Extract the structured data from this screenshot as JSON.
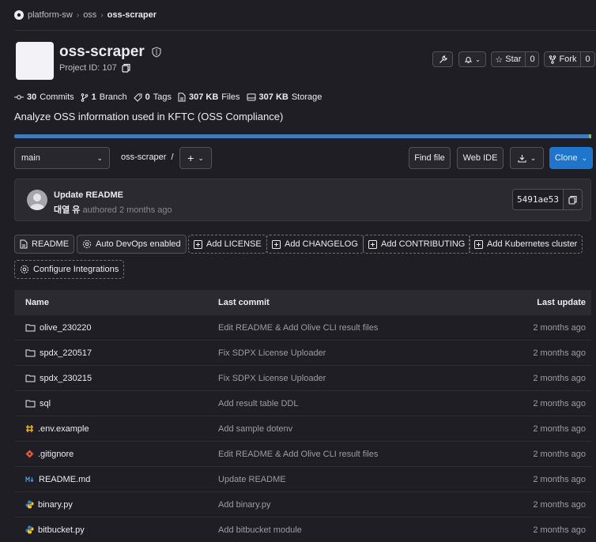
{
  "breadcrumb": {
    "group": "platform-sw",
    "subgroup": "oss",
    "project": "oss-scraper"
  },
  "project": {
    "name": "oss-scraper",
    "id_label": "Project ID: 107"
  },
  "actions": {
    "star_label": "Star",
    "star_count": "0",
    "fork_label": "Fork",
    "fork_count": "0"
  },
  "stats": {
    "commits_count": "30",
    "commits_label": "Commits",
    "branches_count": "1",
    "branches_label": "Branch",
    "tags_count": "0",
    "tags_label": "Tags",
    "files_size": "307 KB",
    "files_label": "Files",
    "storage_size": "307 KB",
    "storage_label": "Storage"
  },
  "description": "Analyze OSS information used in KFTC (OSS Compliance)",
  "language_bar": {
    "colors": [
      "#3f7cbe",
      "#7ec043"
    ]
  },
  "toolbar": {
    "branch": "main",
    "path": "oss-scraper",
    "path_sep": "/",
    "find_file": "Find file",
    "web_ide": "Web IDE",
    "clone": "Clone"
  },
  "last_commit": {
    "title": "Update README",
    "author": "대열 유",
    "meta": "authored 2 months ago",
    "sha": "5491ae53"
  },
  "quick_buttons": [
    {
      "label": "README",
      "style": "solid",
      "icon": "file-icon"
    },
    {
      "label": "Auto DevOps enabled",
      "style": "solid",
      "icon": "settings-icon"
    },
    {
      "label": "Add LICENSE",
      "style": "dashed",
      "icon": "plus-square-icon"
    },
    {
      "label": "Add CHANGELOG",
      "style": "dashed",
      "icon": "plus-square-icon"
    },
    {
      "label": "Add CONTRIBUTING",
      "style": "dashed",
      "icon": "plus-square-icon"
    },
    {
      "label": "Add Kubernetes cluster",
      "style": "dashed",
      "icon": "plus-square-icon"
    },
    {
      "label": "Configure Integrations",
      "style": "dashed",
      "icon": "settings-icon"
    }
  ],
  "table": {
    "headers": {
      "name": "Name",
      "last_commit": "Last commit",
      "last_update": "Last update"
    },
    "rows": [
      {
        "name": "olive_230220",
        "type": "folder",
        "commit": "Edit README & Add Olive CLI result files",
        "updated": "2 months ago"
      },
      {
        "name": "spdx_220517",
        "type": "folder",
        "commit": "Fix SDPX License Uploader",
        "updated": "2 months ago"
      },
      {
        "name": "spdx_230215",
        "type": "folder",
        "commit": "Fix SDPX License Uploader",
        "updated": "2 months ago"
      },
      {
        "name": "sql",
        "type": "folder",
        "commit": "Add result table DDL",
        "updated": "2 months ago"
      },
      {
        "name": ".env.example",
        "type": "env",
        "commit": "Add sample dotenv",
        "updated": "2 months ago"
      },
      {
        "name": ".gitignore",
        "type": "git",
        "commit": "Edit README & Add Olive CLI result files",
        "updated": "2 months ago"
      },
      {
        "name": "README.md",
        "type": "markdown",
        "commit": "Update README",
        "updated": "2 months ago"
      },
      {
        "name": "binary.py",
        "type": "python",
        "commit": "Add binary.py",
        "updated": "2 months ago"
      },
      {
        "name": "bitbucket.py",
        "type": "python",
        "commit": "Add bitbucket module",
        "updated": "2 months ago"
      }
    ]
  }
}
